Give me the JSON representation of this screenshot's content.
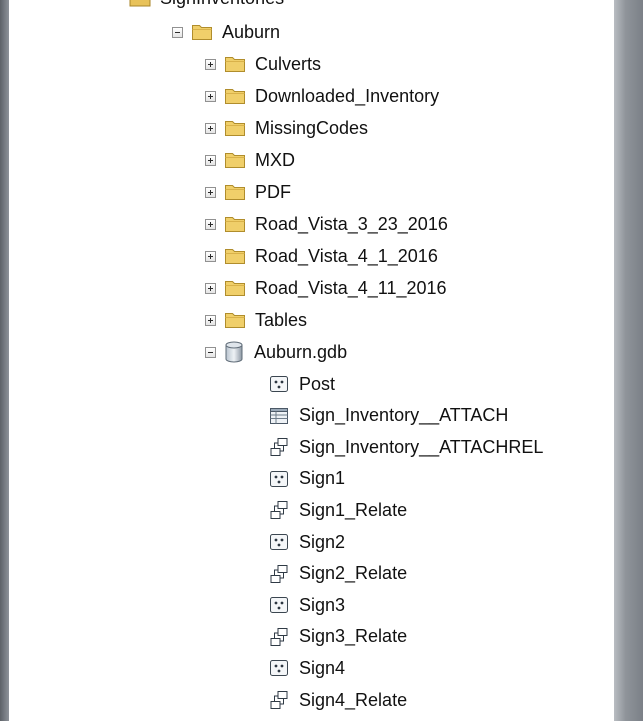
{
  "tree": {
    "partial_top_label": "SignInventories",
    "root": {
      "label": "Auburn",
      "icon": "folder-icon",
      "state": "expanded"
    },
    "folders": [
      {
        "label": "Culverts",
        "state": "collapsed"
      },
      {
        "label": "Downloaded_Inventory",
        "state": "collapsed"
      },
      {
        "label": "MissingCodes",
        "state": "collapsed"
      },
      {
        "label": "MXD",
        "state": "collapsed"
      },
      {
        "label": "PDF",
        "state": "collapsed"
      },
      {
        "label": "Road_Vista_3_23_2016",
        "state": "collapsed"
      },
      {
        "label": "Road_Vista_4_1_2016",
        "state": "collapsed"
      },
      {
        "label": "Road_Vista_4_11_2016",
        "state": "collapsed"
      },
      {
        "label": "Tables",
        "state": "collapsed"
      }
    ],
    "geodatabase": {
      "label": "Auburn.gdb",
      "icon": "geodatabase-icon",
      "state": "expanded"
    },
    "gdb_items": [
      {
        "label": "Post",
        "icon": "point-feature-class-icon"
      },
      {
        "label": "Sign_Inventory__ATTACH",
        "icon": "table-icon"
      },
      {
        "label": "Sign_Inventory__ATTACHREL",
        "icon": "relationship-class-icon"
      },
      {
        "label": "Sign1",
        "icon": "point-feature-class-icon"
      },
      {
        "label": "Sign1_Relate",
        "icon": "relationship-class-icon"
      },
      {
        "label": "Sign2",
        "icon": "point-feature-class-icon"
      },
      {
        "label": "Sign2_Relate",
        "icon": "relationship-class-icon"
      },
      {
        "label": "Sign3",
        "icon": "point-feature-class-icon"
      },
      {
        "label": "Sign3_Relate",
        "icon": "relationship-class-icon"
      },
      {
        "label": "Sign4",
        "icon": "point-feature-class-icon"
      },
      {
        "label": "Sign4_Relate",
        "icon": "relationship-class-icon"
      }
    ]
  }
}
